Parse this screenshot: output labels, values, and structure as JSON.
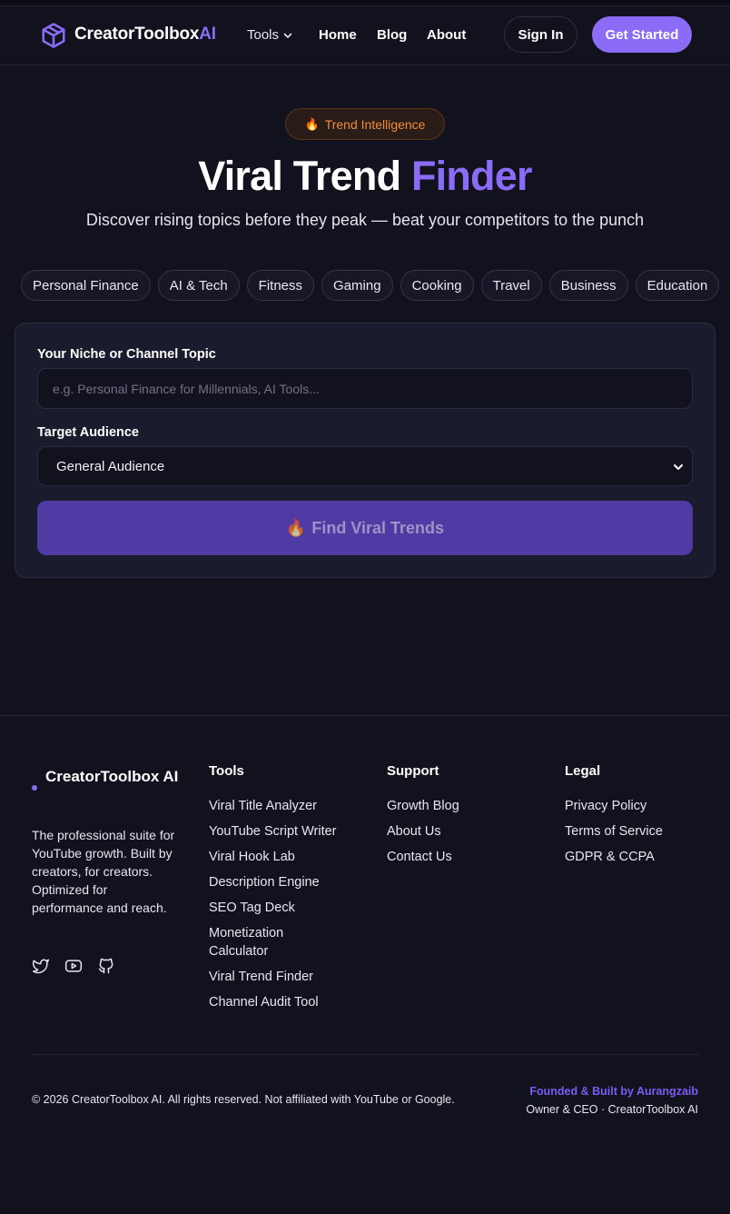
{
  "nav": {
    "brand_main": "CreatorToolbox",
    "brand_accent": "AI",
    "tools_label": "Tools",
    "home_label": "Home",
    "blog_label": "Blog",
    "about_label": "About",
    "signin_label": "Sign In",
    "get_started_label": "Get Started"
  },
  "hero": {
    "badge_label": "Trend Intelligence",
    "title_main": "Viral Trend ",
    "title_accent": "Finder",
    "subtitle": "Discover rising topics before they peak — beat your competitors to the punch"
  },
  "chips": [
    "Personal Finance",
    "AI & Tech",
    "Fitness",
    "Gaming",
    "Cooking",
    "Travel",
    "Business",
    "Education"
  ],
  "form": {
    "niche_label": "Your Niche or Channel Topic",
    "niche_value": "",
    "niche_placeholder": "e.g. Personal Finance for Millennials, AI Tools...",
    "audience_label": "Target Audience",
    "audience_value": "General Audience",
    "submit_label": "Find Viral Trends"
  },
  "footer": {
    "brand": "CreatorToolbox AI",
    "description": "The professional suite for YouTube growth. Built by creators, for creators. Optimized for performance and reach.",
    "social_icons": [
      "twitter-icon",
      "youtube-icon",
      "github-icon"
    ],
    "tools_title": "Tools",
    "tools_links": [
      "Viral Title Analyzer",
      "YouTube Script Writer",
      "Viral Hook Lab",
      "Description Engine",
      "SEO Tag Deck",
      "Monetization Calculator",
      "Viral Trend Finder",
      "Channel Audit Tool"
    ],
    "support_title": "Support",
    "support_links": [
      "Growth Blog",
      "About Us",
      "Contact Us"
    ],
    "legal_title": "Legal",
    "legal_links": [
      "Privacy Policy",
      "Terms of Service",
      "GDPR & CCPA"
    ],
    "copyright": "© 2026 CreatorToolbox AI. All rights reserved. Not affiliated with YouTube or Google.",
    "founded": "Founded & Built by Aurangzaib",
    "owner": "Owner & CEO · CreatorToolbox AI"
  },
  "colors": {
    "accent": "#8b6cf6",
    "background": "#12121f",
    "badge_text": "#f28c3a",
    "button_disabled": "#4f3ba3"
  }
}
